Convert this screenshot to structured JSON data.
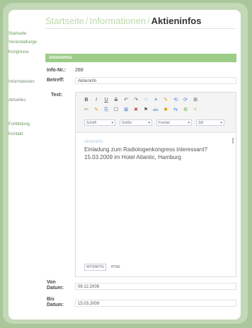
{
  "nav": [
    {
      "label": "Startseite",
      "muted": false
    },
    {
      "label": "Veranstaltungen",
      "muted": false
    },
    {
      "label": "Kongresse",
      "muted": false
    },
    {
      "label": "Informationen",
      "muted": true
    },
    {
      "label": "Aktuelles",
      "muted": true
    },
    {
      "label": "Fortbildung",
      "muted": false
    },
    {
      "label": "Kontakt",
      "muted": false
    }
  ],
  "breadcrumb": {
    "items": [
      "Startseite",
      "Informationen",
      "Aktieninfos"
    ],
    "separator": "/"
  },
  "panel": {
    "title": "Aktieninfos"
  },
  "form": {
    "info_nr_label": "Info-Nr.:",
    "info_nr_value": "288",
    "betreff_label": "Betreff:",
    "betreff_value": "Aktieninfo",
    "text_label": "Text:",
    "von_label": "Von Datum:",
    "von_value": "09.12.2008",
    "bis_label": "Bis Datum:",
    "bis_value": "15.03.2009"
  },
  "toolbar": {
    "row1": [
      "B",
      "I",
      "U",
      "S",
      "↶",
      "↷",
      "⁘",
      "≡",
      "✎",
      "⟲",
      "⟳",
      "⊞"
    ],
    "row2": [
      "✂",
      "✎",
      "⎘",
      "☐",
      "⊠",
      "✖",
      "⚑",
      "abc",
      "✱",
      "⇆",
      "⚙",
      "✧"
    ],
    "fonts": "Schrift",
    "size": "Größe",
    "format": "Format",
    "extra": "Stil"
  },
  "editor": {
    "placeholder": "Aktieninfo",
    "line1": "Einladung zum Radiologenkongress interessant?",
    "line2": "15.03.2009 im Hotel Atlantic, Hamburg"
  },
  "modes": {
    "wysiwyg": "WYSIWYG",
    "html": "HTML"
  }
}
